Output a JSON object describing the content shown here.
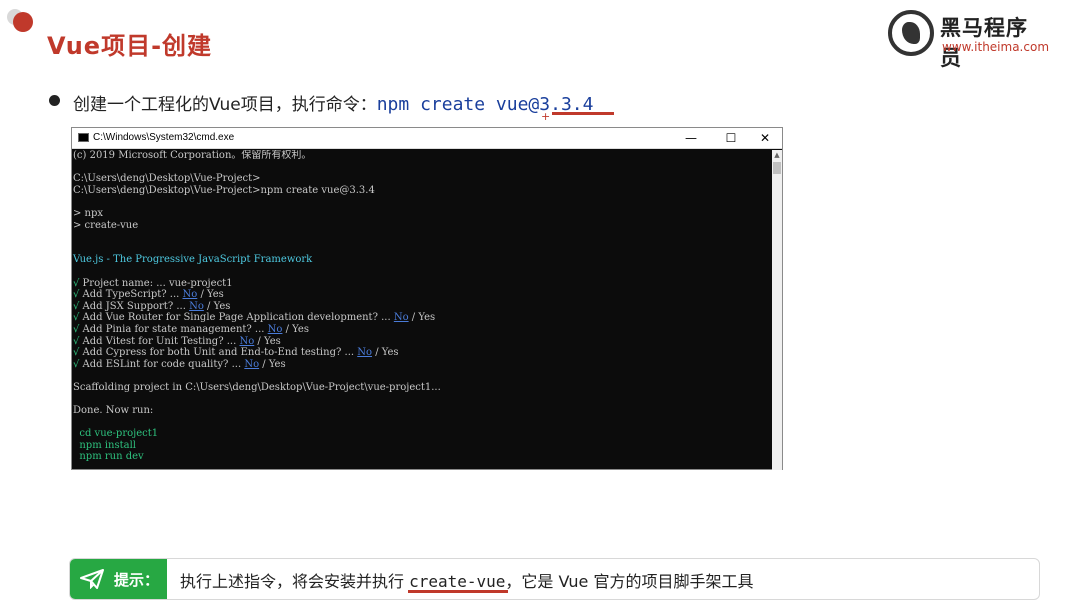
{
  "slide": {
    "title": "Vue项目-创建",
    "logo_name": "黑马程序员",
    "logo_url": "www.itheima.com",
    "bullet_prefix": "创建一个工程化的Vue项目，执行命令：",
    "bullet_command": "npm create vue@3.3.4",
    "plus_mark": "+"
  },
  "window": {
    "title": "C:\\Windows\\System32\\cmd.exe",
    "min_label": "—",
    "max_label": "☐",
    "close_label": "✕"
  },
  "console": {
    "copyright": "(c) 2019 Microsoft Corporation。保留所有权利。",
    "prompt1": "C:\\Users\\deng\\Desktop\\Vue-Project>",
    "prompt2": "C:\\Users\\deng\\Desktop\\Vue-Project>npm create vue@3.3.4",
    "npx": "> npx",
    "create_vue": "> create-vue",
    "banner": "Vue.js - The Progressive JavaScript Framework",
    "questions": [
      {
        "check": "√",
        "text": " Project name: ... ",
        "answer": "vue-project1",
        "no": "",
        "rest": ""
      },
      {
        "check": "√",
        "text": " Add TypeScript? ... ",
        "answer": "",
        "no": "No",
        "rest": " / Yes"
      },
      {
        "check": "√",
        "text": " Add JSX Support? ... ",
        "answer": "",
        "no": "No",
        "rest": " / Yes"
      },
      {
        "check": "√",
        "text": " Add Vue Router for Single Page Application development? ... ",
        "answer": "",
        "no": "No",
        "rest": " / Yes"
      },
      {
        "check": "√",
        "text": " Add Pinia for state management? ... ",
        "answer": "",
        "no": "No",
        "rest": " / Yes"
      },
      {
        "check": "√",
        "text": " Add Vitest for Unit Testing? ... ",
        "answer": "",
        "no": "No",
        "rest": " / Yes"
      },
      {
        "check": "√",
        "text": " Add Cypress for both Unit and End-to-End testing? ... ",
        "answer": "",
        "no": "No",
        "rest": " / Yes"
      },
      {
        "check": "√",
        "text": " Add ESLint for code quality? ... ",
        "answer": "",
        "no": "No",
        "rest": " / Yes"
      }
    ],
    "scaffolding": "Scaffolding project in C:\\Users\\deng\\Desktop\\Vue-Project\\vue-project1...",
    "done": "Done. Now run:",
    "cmd1": "  cd vue-project1",
    "cmd2": "  npm install",
    "cmd3": "  npm run dev"
  },
  "tip": {
    "label": "提示：",
    "text_before": "执行上述指令，将会安装并执行 ",
    "code": "create-vue",
    "text_after": "，它是 Vue 官方的项目脚手架工具"
  },
  "colors": {
    "accent_red": "#c0392b",
    "tip_green": "#27a843",
    "console_green": "#2ec27e",
    "console_link": "#4a7bd8"
  }
}
